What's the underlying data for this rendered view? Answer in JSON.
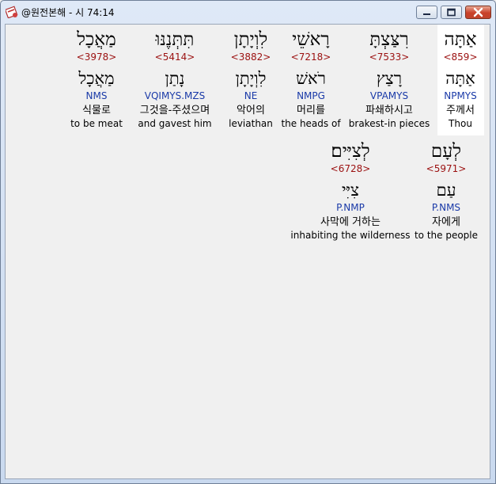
{
  "window": {
    "title": "@원전본해 - 시 74:14"
  },
  "icons": {
    "app": "bible-app-icon",
    "minimize": "minimize-icon",
    "maximize": "maximize-icon",
    "close": "close-icon"
  },
  "row1": [
    {
      "word": "אַתָּה",
      "strong": "<859>",
      "lemma": "אַתָּה",
      "morph": "NPMYS",
      "kor": "주께서",
      "eng": "Thou"
    },
    {
      "word": "רִצַּצְתָּ",
      "strong": "<7533>",
      "lemma": "רָצַץ",
      "morph": "VPAMYS",
      "kor": "파쇄하시고",
      "eng": "brakest-in pieces"
    },
    {
      "word": "רָאשֵׁי",
      "strong": "<7218>",
      "lemma": "רֹאשׁ",
      "morph": "NMPG",
      "kor": "머리를",
      "eng": "the heads of"
    },
    {
      "word": "לִוְיָתָן",
      "strong": "<3882>",
      "lemma": "לִוְיָתָן",
      "morph": "NE",
      "kor": "악어의",
      "eng": "leviathan"
    },
    {
      "word": "תִּתְּנֶנּוּ",
      "strong": "<5414>",
      "lemma": "נָתַן",
      "morph": "VQIMYS.MZS",
      "kor": "그것을-주셨으며",
      "eng": "and gavest him"
    },
    {
      "word": "מַאֲכָל",
      "strong": "<3978>",
      "lemma": "מַאֲכָל",
      "morph": "NMS",
      "kor": "식물로",
      "eng": "to be meat"
    }
  ],
  "row2": [
    {
      "word": "לְעָם",
      "strong": "<5971>",
      "lemma": "עַם",
      "morph": "P.NMS",
      "kor": "자에게",
      "eng": "to the people"
    },
    {
      "word": "לְצִיִּים׃",
      "strong": "<6728>",
      "lemma": "צִיִּי",
      "morph": "P.NMP",
      "kor": "사막에 거하는",
      "eng": "inhabiting the wilderness"
    }
  ]
}
